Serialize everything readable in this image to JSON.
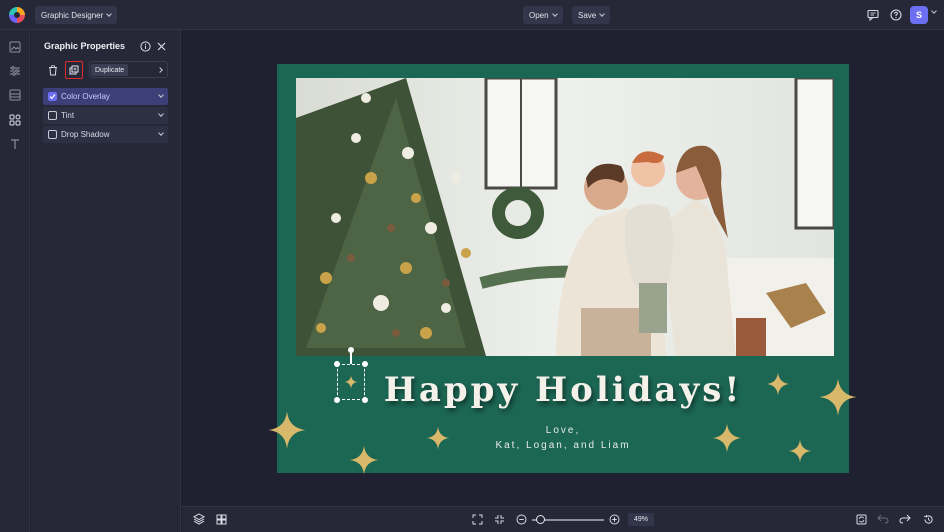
{
  "app": {
    "mode_label": "Graphic Designer"
  },
  "header": {
    "open_label": "Open",
    "save_label": "Save",
    "avatar_initial": "S"
  },
  "rail": {
    "icons": [
      "image-icon",
      "sliders-icon",
      "layout-icon",
      "graphics-icon",
      "text-icon"
    ]
  },
  "panel": {
    "title": "Graphic Properties",
    "tooltip": "Duplicate",
    "properties": [
      {
        "label": "Color Overlay",
        "checked": true
      },
      {
        "label": "Tint",
        "checked": false
      },
      {
        "label": "Drop Shadow",
        "checked": false
      }
    ]
  },
  "design": {
    "headline": "Happy Holidays!",
    "message": "Love,",
    "names": "Kat, Logan, and Liam",
    "background_color": "#1c6654",
    "star_color": "#d8b86a"
  },
  "bottom": {
    "zoom": "49%",
    "zoom_fraction": 0.49
  }
}
